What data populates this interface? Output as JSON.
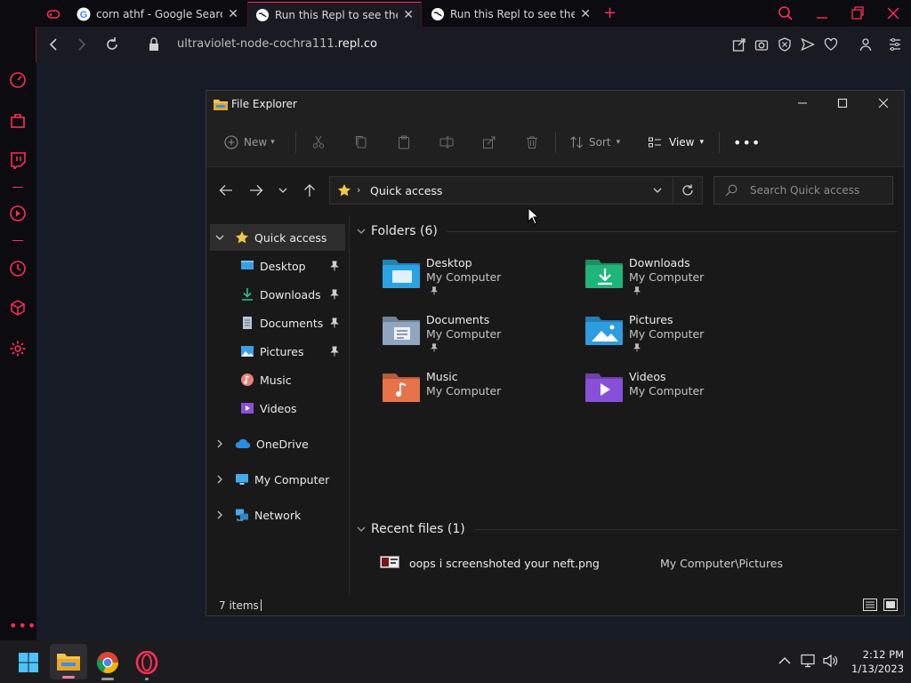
{
  "browser": {
    "tabs": [
      {
        "title": "",
        "icon": "gamepad-icon"
      },
      {
        "title": "corn athf - Google Search",
        "icon": "google-icon"
      },
      {
        "title": "Run this Repl to see the res",
        "icon": "globe-icon",
        "active": true
      },
      {
        "title": "Run this Repl to see the res",
        "icon": "globe-icon"
      }
    ],
    "url_prefix": "ultraviolet-node-cochra111.",
    "url_host": "repl.co",
    "accent": "#ff2d55"
  },
  "explorer": {
    "title": "File Explorer",
    "toolbar": {
      "new_label": "New",
      "sort_label": "Sort",
      "view_label": "View"
    },
    "breadcrumb": "Quick access",
    "search_placeholder": "Search Quick access",
    "tree": {
      "quick_access": "Quick access",
      "pinned": [
        {
          "label": "Desktop",
          "icon": "desktop-icon",
          "pinned": true
        },
        {
          "label": "Downloads",
          "icon": "downloads-icon",
          "pinned": true
        },
        {
          "label": "Documents",
          "icon": "documents-icon",
          "pinned": true
        },
        {
          "label": "Pictures",
          "icon": "pictures-icon",
          "pinned": true
        },
        {
          "label": "Music",
          "icon": "music-icon",
          "pinned": false
        },
        {
          "label": "Videos",
          "icon": "videos-icon",
          "pinned": false
        }
      ],
      "onedrive": "OneDrive",
      "my_computer": "My Computer",
      "network": "Network"
    },
    "folders_header": "Folders (6)",
    "folders": [
      {
        "name": "Desktop",
        "location": "My Computer",
        "pinned": true,
        "color": "#29a3e6"
      },
      {
        "name": "Downloads",
        "location": "My Computer",
        "pinned": true,
        "color": "#1fb57a"
      },
      {
        "name": "Documents",
        "location": "My Computer",
        "pinned": true,
        "color": "#8fa6c0"
      },
      {
        "name": "Pictures",
        "location": "My Computer",
        "pinned": true,
        "color": "#2b9de0"
      },
      {
        "name": "Music",
        "location": "My Computer",
        "pinned": false,
        "color": "#e8734a"
      },
      {
        "name": "Videos",
        "location": "My Computer",
        "pinned": false,
        "color": "#8a4fd8"
      }
    ],
    "recent_header": "Recent files (1)",
    "recent": [
      {
        "name": "oops i screenshoted your neft.png",
        "path": "My Computer\\Pictures"
      }
    ],
    "status": "7 items"
  },
  "taskbar": {
    "time": "2:12 PM",
    "date": "1/13/2023"
  }
}
